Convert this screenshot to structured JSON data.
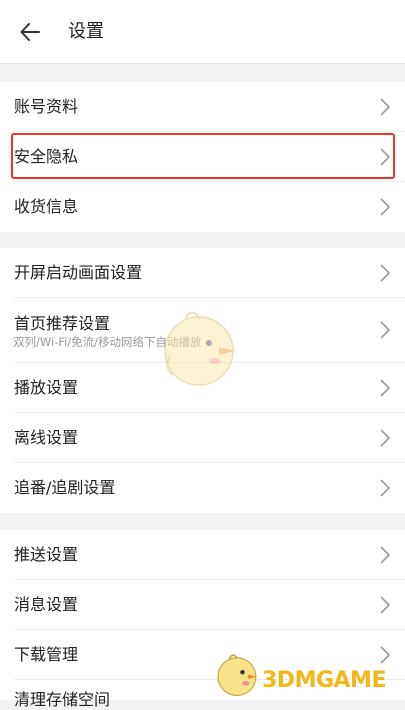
{
  "header": {
    "title": "设置",
    "back_icon": "arrow-left-icon"
  },
  "group1": [
    {
      "label": "账号资料"
    },
    {
      "label": "安全隐私"
    },
    {
      "label": "收货信息"
    }
  ],
  "group2": [
    {
      "label": "开屏启动画面设置"
    },
    {
      "label": "首页推荐设置",
      "sub": "双列/Wi-Fi/免流/移动网络下自动播放"
    },
    {
      "label": "播放设置"
    },
    {
      "label": "离线设置"
    },
    {
      "label": "追番/追剧设置"
    }
  ],
  "group3": [
    {
      "label": "推送设置"
    },
    {
      "label": "消息设置"
    },
    {
      "label": "下载管理"
    },
    {
      "label": "清理存储空间"
    }
  ],
  "watermark": {
    "text": "3DMGAME"
  },
  "colors": {
    "highlight": "#e8332e",
    "watermark": "#f2b619",
    "background": "#f2f2f2"
  }
}
